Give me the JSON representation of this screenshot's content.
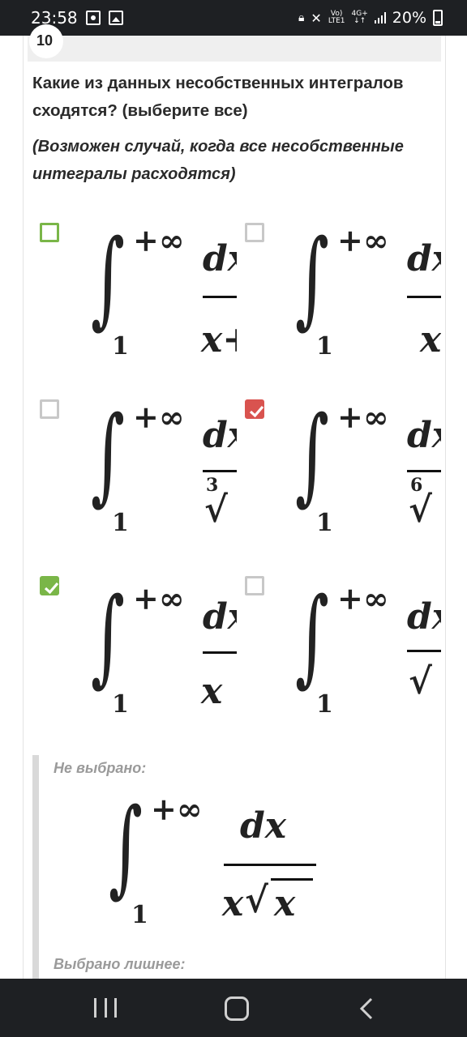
{
  "status_bar": {
    "time": "23:58",
    "net_top": "Vo)",
    "net_bottom": "LTE1",
    "gen_top": "4G+",
    "gen_bottom": "↓↑",
    "battery": "20%"
  },
  "question": {
    "number": "10",
    "text": "Какие из данных несобственных интегралов сходятся? (выберите все)",
    "note": "(Возможен случай, когда все несобственные интегралы расходятся)"
  },
  "options": [
    {
      "state": "unchecked-highlight",
      "upper": "+∞",
      "lower": "1",
      "num": "dx",
      "den": "x+",
      "den_root_index": ""
    },
    {
      "state": "unchecked",
      "upper": "+∞",
      "lower": "1",
      "num": "dx",
      "den": "x",
      "den_root_index": ""
    },
    {
      "state": "unchecked",
      "upper": "+∞",
      "lower": "1",
      "num": "dx",
      "den": "√",
      "den_root_index": "3"
    },
    {
      "state": "checked-red",
      "upper": "+∞",
      "lower": "1",
      "num": "dx",
      "den": "√",
      "den_root_index": "6"
    },
    {
      "state": "checked-green",
      "upper": "+∞",
      "lower": "1",
      "num": "dx",
      "den": "x",
      "den_root_index": ""
    },
    {
      "state": "unchecked",
      "upper": "+∞",
      "lower": "1",
      "num": "dx",
      "den": "√",
      "den_root_index": ""
    }
  ],
  "feedback": {
    "not_selected_label": "Не выбрано:",
    "not_selected_formula": {
      "upper": "+∞",
      "lower": "1",
      "num": "dx",
      "den_x": "x",
      "den_root": "√",
      "den_radicand": "x"
    },
    "extra_selected_label": "Выбрано лишнее:"
  },
  "colors": {
    "correct": "#7ab648",
    "wrong": "#d9534f",
    "accent_bar": "#d9d9d9"
  }
}
